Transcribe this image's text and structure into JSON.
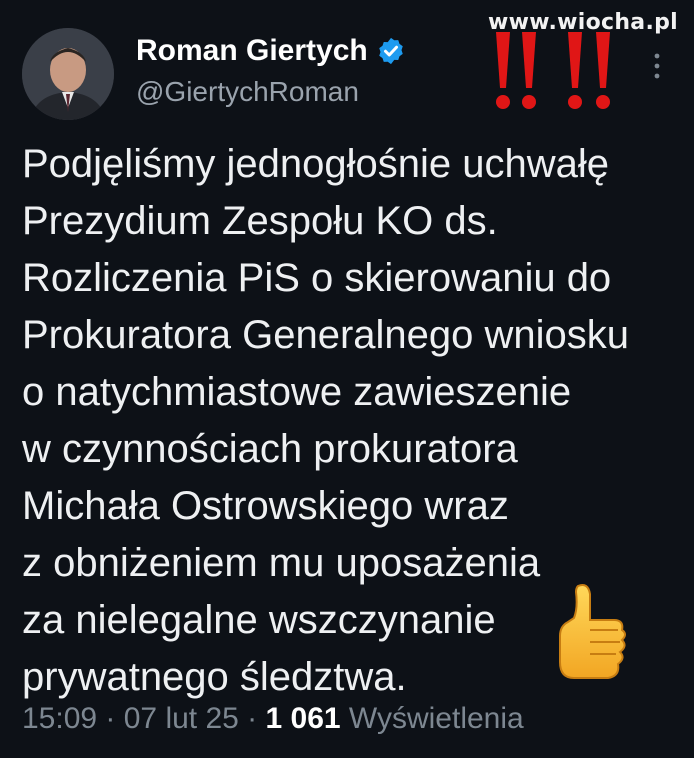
{
  "watermark": "www.wiocha.pl",
  "author": {
    "name": "Roman Giertych",
    "handle": "@GiertychRoman",
    "verified_icon": "verified-badge-icon",
    "verified_color": "#1d9bf0"
  },
  "tweet": {
    "lines": [
      "Podjęliśmy jednogłośnie uchwałę",
      "Prezydium Zespołu KO ds.",
      "Rozliczenia PiS o skierowaniu do",
      "Prokuratora Generalnego wniosku",
      "o natychmiastowe zawieszenie",
      "w czynnościach prokuratora",
      "Michała Ostrowskiego wraz",
      "z obniżeniem mu uposażenia",
      "za nielegalne wszczynanie",
      "prywatnego śledztwa."
    ],
    "emoji": "thumbs-up-icon"
  },
  "meta": {
    "time": "15:09",
    "separator1": " · ",
    "date": "07 lut 25",
    "separator2": " · ",
    "views_count": "1 061",
    "views_label": " Wyświetlenia"
  },
  "decorations": {
    "exclamation_marks": "double-exclamation-icon",
    "exclamation_color": "#e01616"
  }
}
